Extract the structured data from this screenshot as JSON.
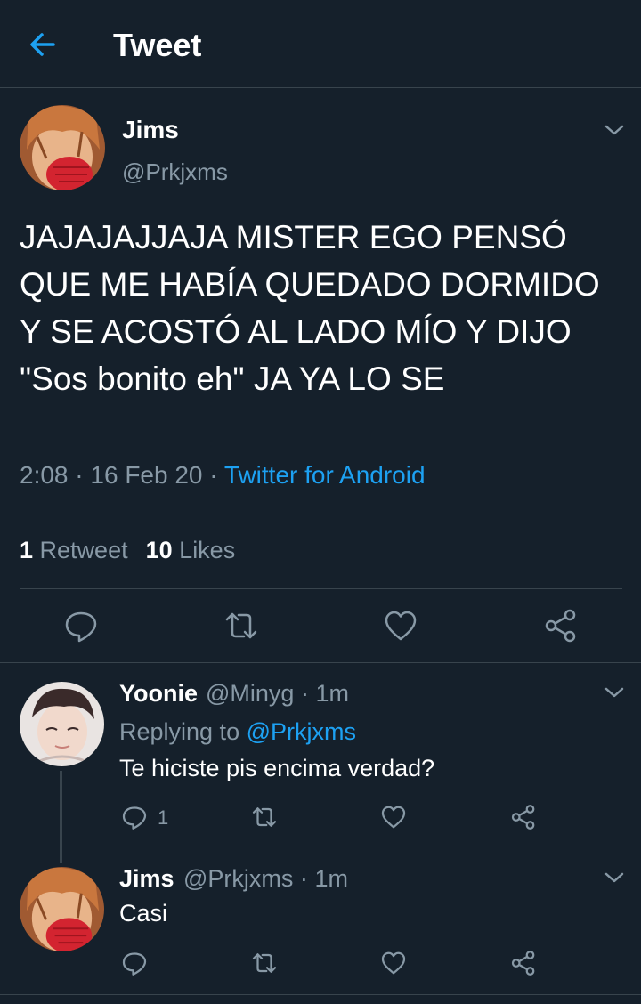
{
  "header": {
    "title": "Tweet",
    "back_icon": "arrow-left-icon",
    "accent": "#1da1f2"
  },
  "tweet": {
    "name": "Jims",
    "handle": "@Prkjxms",
    "text": "JAJAJAJJAJA MISTER EGO PENSÓ QUE ME HABÍA QUEDADO DORMIDO Y SE ACOSTÓ AL LADO MÍO Y DIJO \"Sos bonito eh\" JA YA LO SE",
    "time": "2:08",
    "date": "16 Feb 20",
    "source": "Twitter for Android",
    "retweets_count": "1",
    "retweets_label": "Retweet",
    "likes_count": "10",
    "likes_label": "Likes",
    "actions": [
      "reply-icon",
      "retweet-icon",
      "like-icon",
      "share-icon"
    ]
  },
  "replies": [
    {
      "name": "Yoonie",
      "handle": "@Minyg",
      "time": "1m",
      "replying_label": "Replying to",
      "replying_to": "@Prkjxms",
      "text": "Te hiciste pis encima verdad?",
      "reply_count": "1"
    },
    {
      "name": "Jims",
      "handle": "@Prkjxms",
      "time": "1m",
      "text": "Casi"
    }
  ],
  "separator": "·",
  "colors": {
    "background": "#15202b",
    "border": "#38444d",
    "secondary_text": "#8899a6",
    "link": "#1da1f2"
  }
}
